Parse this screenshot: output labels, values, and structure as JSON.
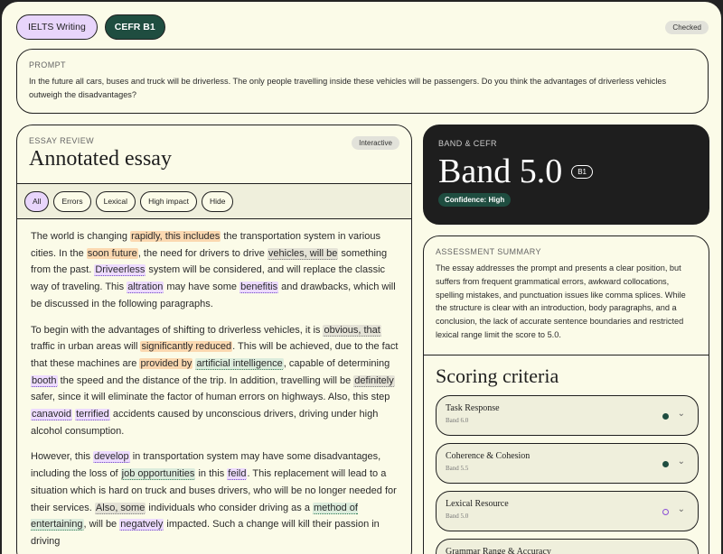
{
  "header": {
    "chip_ielts": "IELTS Writing",
    "chip_cefr": "CEFR B1",
    "status": "Checked"
  },
  "prompt": {
    "label": "PROMPT",
    "text": "In the future all cars, buses and truck will be driverless. The only people travelling inside these vehicles will be passengers. Do you think the advantages of driverless vehicles outweigh the disadvantages?"
  },
  "essay": {
    "label": "ESSAY REVIEW",
    "badge": "Interactive",
    "title": "Annotated essay",
    "filters": [
      "All",
      "Errors",
      "Lexical",
      "High impact",
      "Hide"
    ],
    "paragraphs": [
      [
        {
          "t": "The world is changing "
        },
        {
          "t": "rapidly, this includes",
          "c": "orange"
        },
        {
          "t": " the transportation system in various cities. In the "
        },
        {
          "t": "soon future",
          "c": "orange"
        },
        {
          "t": ", the need for drivers to drive "
        },
        {
          "t": "vehicles, will be",
          "c": "gray"
        },
        {
          "t": " something from the past. "
        },
        {
          "t": "Driveerless",
          "c": "purple"
        },
        {
          "t": " system will be considered, and will replace the classic way of traveling. This "
        },
        {
          "t": "altration",
          "c": "purple"
        },
        {
          "t": " may have some "
        },
        {
          "t": "benefitis",
          "c": "purple"
        },
        {
          "t": " and drawbacks, which will be discussed in the following paragraphs."
        }
      ],
      [
        {
          "t": "To begin with the advantages of shifting to driverless vehicles, it is "
        },
        {
          "t": "obvious, that",
          "c": "gray"
        },
        {
          "t": " traffic in urban areas will "
        },
        {
          "t": "significantly reduced",
          "c": "orange"
        },
        {
          "t": ". This will be achieved, due to the fact that these machines are "
        },
        {
          "t": "provided by",
          "c": "orange"
        },
        {
          "t": " "
        },
        {
          "t": "artificial intelligence",
          "c": "green"
        },
        {
          "t": ", capable of determining "
        },
        {
          "t": "booth",
          "c": "purple"
        },
        {
          "t": " the speed and the distance of the trip. In addition, travelling will be "
        },
        {
          "t": "definitely",
          "c": "gray"
        },
        {
          "t": " safer, since it will eliminate the factor of human errors on highways. Also, this step "
        },
        {
          "t": "canavoid",
          "c": "purple"
        },
        {
          "t": " "
        },
        {
          "t": "terrified",
          "c": "purple"
        },
        {
          "t": " accidents caused by unconscious drivers, driving under high alcohol consumption."
        }
      ],
      [
        {
          "t": "However, this "
        },
        {
          "t": "develop",
          "c": "purple"
        },
        {
          "t": " in transportation system may have some disadvantages, including the loss of "
        },
        {
          "t": "job opportunities",
          "c": "green"
        },
        {
          "t": " in this "
        },
        {
          "t": "feild",
          "c": "purple"
        },
        {
          "t": ". This replacement will lead to a situation which is hard on truck and buses drivers, who will be no longer needed for their services. "
        },
        {
          "t": "Also, some",
          "c": "gray"
        },
        {
          "t": " individuals who consider driving as a "
        },
        {
          "t": "method of entertaining",
          "c": "green"
        },
        {
          "t": ", will be "
        },
        {
          "t": "negatvely",
          "c": "purple"
        },
        {
          "t": " impacted. Such a change will kill their passion in driving"
        }
      ]
    ]
  },
  "band": {
    "label": "BAND & CEFR",
    "value": "Band 5.0",
    "cefr": "B1",
    "confidence": "Confidence: High"
  },
  "summary": {
    "label": "ASSESSMENT SUMMARY",
    "text": "The essay addresses the prompt and presents a clear position, but suffers from frequent grammatical errors, awkward collocations, spelling mistakes, and punctuation issues like comma splices. While the structure is clear with an introduction, body paragraphs, and a conclusion, the lack of accurate sentence boundaries and restricted lexical range limit the score to 5.0."
  },
  "criteria": {
    "title": "Scoring criteria",
    "items": [
      {
        "name": "Task Response",
        "band": "Band 6.0",
        "dot": "filled"
      },
      {
        "name": "Coherence & Cohesion",
        "band": "Band 5.5",
        "dot": "filled"
      },
      {
        "name": "Lexical Resource",
        "band": "Band 5.0",
        "dot": "empty"
      },
      {
        "name": "Grammar Range & Accuracy",
        "band": "",
        "dot": "empty"
      }
    ]
  },
  "colors": {
    "accent_purple": "#e8d5fb",
    "accent_green": "#1f4d40",
    "highlight_orange": "#fbd8b0",
    "background": "#fbfbe8"
  }
}
